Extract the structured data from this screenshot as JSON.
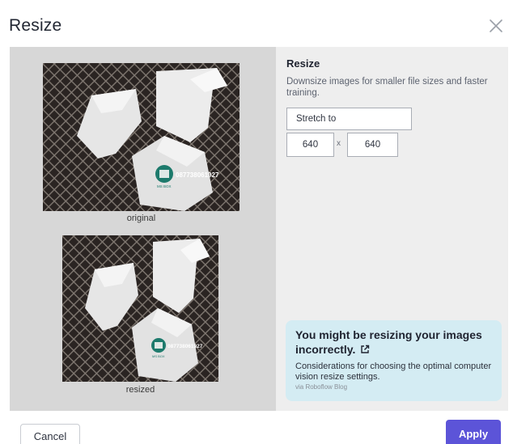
{
  "modal": {
    "title": "Resize",
    "close_icon": "close-icon"
  },
  "preview": {
    "original_caption": "original",
    "resized_caption": "resized",
    "watermark_phone": "087738061927",
    "watermark_logo_text": "MS BOX"
  },
  "settings": {
    "heading": "Resize",
    "description": "Downsize images for smaller file sizes and faster training.",
    "mode_value": "Stretch to",
    "width": "640",
    "times_symbol": "x",
    "height": "640"
  },
  "tip": {
    "title": "You might be resizing your images incorrectly.",
    "text": "Considerations for choosing the optimal computer vision resize settings.",
    "source": "via Roboflow Blog",
    "link_icon": "external-link-icon"
  },
  "footer": {
    "cancel_label": "Cancel",
    "apply_label": "Apply"
  },
  "colors": {
    "accent": "#5c54d8",
    "tip_background": "#d4ecf3",
    "preview_panel": "#d7d7d7",
    "settings_panel": "#eeeeee"
  }
}
